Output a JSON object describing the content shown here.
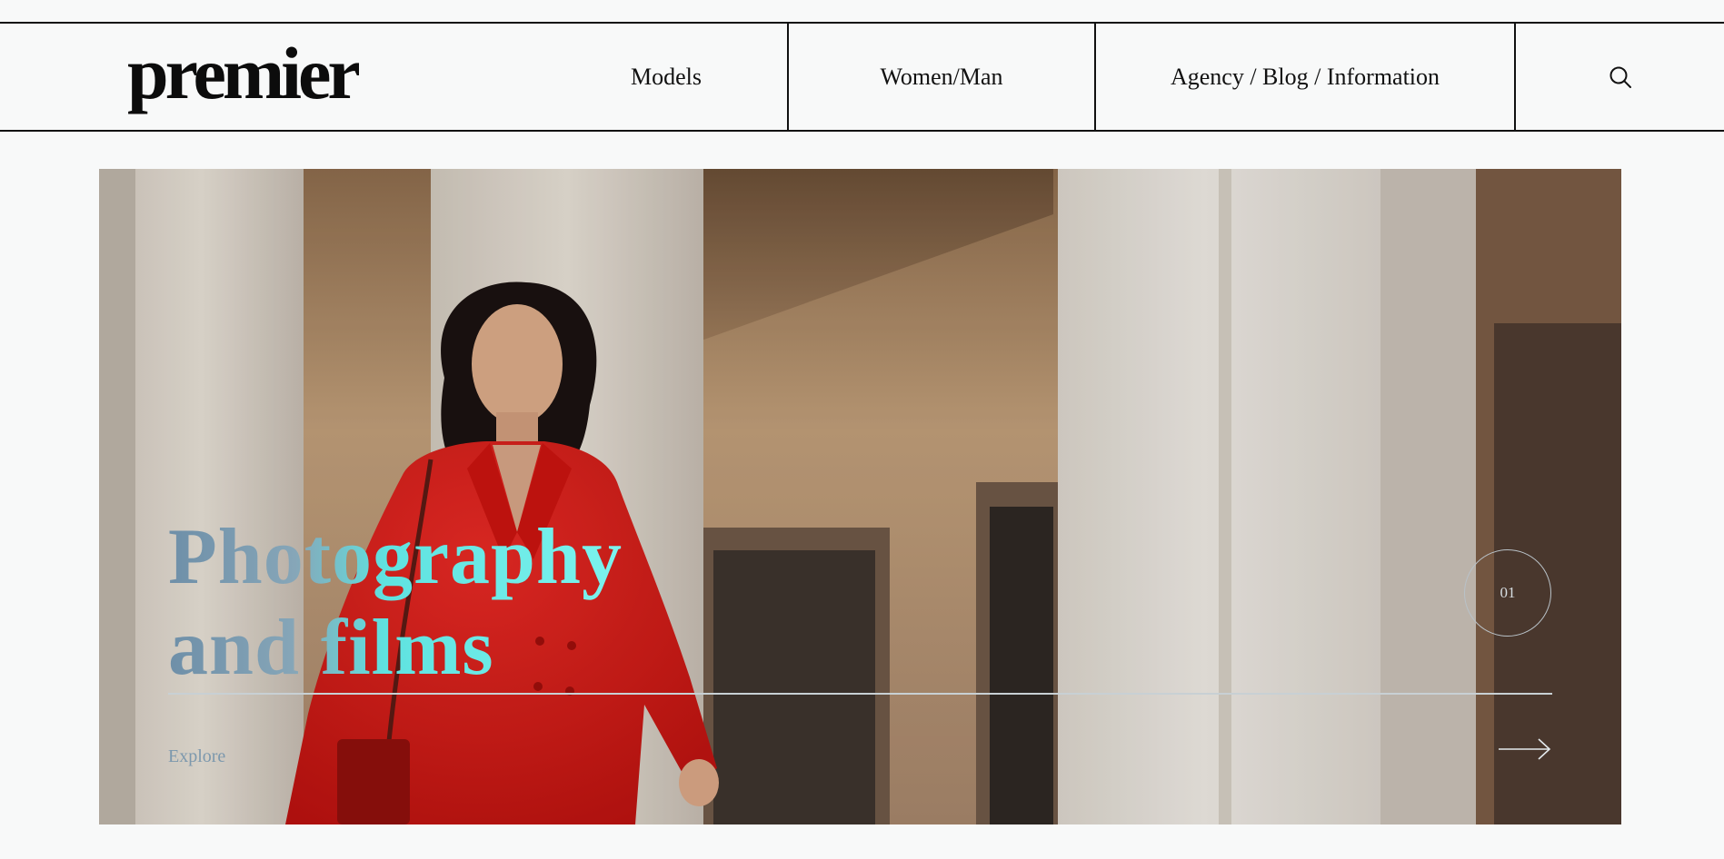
{
  "header": {
    "logo_text": "premier",
    "nav": {
      "models_label": "Models",
      "gender_label": "Women/Man",
      "agency_label": "Agency / Blog / Information"
    },
    "search_icon": "search-icon"
  },
  "hero": {
    "title_line1": "Photography",
    "title_line2": "and films",
    "explore_label": "Explore",
    "slide_number": "01",
    "next_icon": "arrow-right-icon",
    "colors": {
      "dress": "#d31a1a",
      "title_gradient_start": "#6e8fa8",
      "title_gradient_end": "#7cf3ee"
    }
  }
}
